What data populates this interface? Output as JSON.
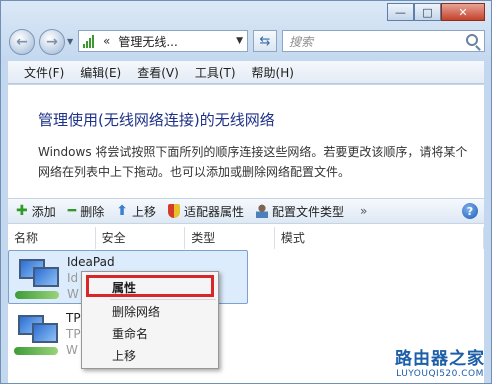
{
  "window": {
    "caption": {
      "minimize": "—",
      "maximize": "□",
      "close": "✕"
    }
  },
  "address_bar": {
    "chevron": "«",
    "path": "管理无线...",
    "search_placeholder": "搜索"
  },
  "menu": [
    "文件(F)",
    "编辑(E)",
    "查看(V)",
    "工具(T)",
    "帮助(H)"
  ],
  "page": {
    "heading": "管理使用(无线网络连接)的无线网络",
    "description": "Windows 将尝试按照下面所列的顺序连接这些网络。若要更改该顺序，请将某个网络在列表中上下拖动。也可以添加或删除网络配置文件。"
  },
  "toolbar": {
    "add": "添加",
    "remove": "删除",
    "move_up": "上移",
    "adapter": "适配器属性",
    "profile_type": "配置文件类型",
    "more": "»",
    "help": "?"
  },
  "columns": [
    "名称",
    "安全",
    "类型",
    "模式"
  ],
  "networks": [
    {
      "name": "IdeaPad",
      "line2": "Id",
      "line3": "W"
    },
    {
      "name": "TP",
      "line2": "TP",
      "line3": "W"
    }
  ],
  "context_menu": [
    "属性",
    "删除网络",
    "重命名",
    "上移"
  ],
  "watermark": {
    "title": "路由器之家",
    "url": "LUYOUQI520.COM"
  }
}
